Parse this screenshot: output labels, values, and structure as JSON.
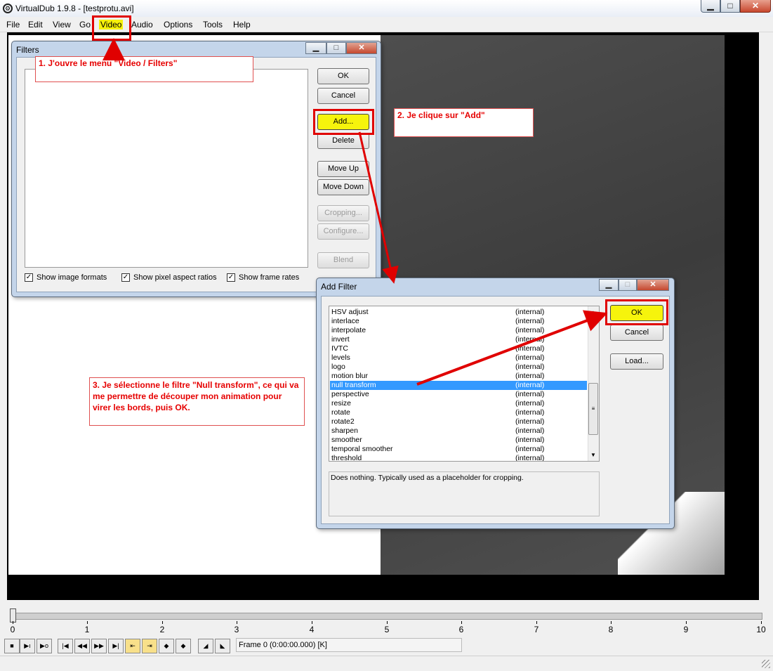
{
  "window": {
    "title": "VirtualDub 1.9.8 - [testprotu.avi]",
    "minimize": "▁",
    "maximize": "□",
    "close": "✕"
  },
  "menu": {
    "items": [
      "File",
      "Edit",
      "View",
      "Go",
      "Video",
      "Audio",
      "Options",
      "Tools",
      "Help"
    ]
  },
  "filters_dialog": {
    "title": "Filters",
    "buttons": {
      "ok": "OK",
      "cancel": "Cancel",
      "add": "Add...",
      "delete": "Delete",
      "move_up": "Move Up",
      "move_down": "Move Down",
      "cropping": "Cropping...",
      "configure": "Configure...",
      "blend": "Blend"
    },
    "checkboxes": {
      "show_image_formats": "Show image formats",
      "show_pixel_aspect_ratios": "Show pixel aspect ratios",
      "show_frame_rates": "Show frame rates"
    }
  },
  "add_filter_dialog": {
    "title": "Add Filter",
    "buttons": {
      "ok": "OK",
      "cancel": "Cancel",
      "load": "Load..."
    },
    "filters": [
      {
        "name": "HSV adjust",
        "source": "(internal)"
      },
      {
        "name": "interlace",
        "source": "(internal)"
      },
      {
        "name": "interpolate",
        "source": "(internal)"
      },
      {
        "name": "invert",
        "source": "(internal)"
      },
      {
        "name": "IVTC",
        "source": "(internal)"
      },
      {
        "name": "levels",
        "source": "(internal)"
      },
      {
        "name": "logo",
        "source": "(internal)"
      },
      {
        "name": "motion blur",
        "source": "(internal)"
      },
      {
        "name": "null transform",
        "source": "(internal)",
        "selected": true
      },
      {
        "name": "perspective",
        "source": "(internal)"
      },
      {
        "name": "resize",
        "source": "(internal)"
      },
      {
        "name": "rotate",
        "source": "(internal)"
      },
      {
        "name": "rotate2",
        "source": "(internal)"
      },
      {
        "name": "sharpen",
        "source": "(internal)"
      },
      {
        "name": "smoother",
        "source": "(internal)"
      },
      {
        "name": "temporal smoother",
        "source": "(internal)"
      },
      {
        "name": "threshold",
        "source": "(internal)"
      }
    ],
    "description": "Does nothing. Typically used as a placeholder for cropping."
  },
  "annotations": {
    "step1": "1. J'ouvre le menu \"Video / Filters\"",
    "step2": "2. Je clique sur \"Add\"",
    "step3": "3. Je sélectionne le filtre \"Null transform\", ce qui va me permettre de découper mon animation pour virer les bords, puis OK."
  },
  "timeline": {
    "ticks": [
      "0",
      "1",
      "2",
      "3",
      "4",
      "5",
      "6",
      "7",
      "8",
      "9",
      "10"
    ],
    "position": 0,
    "frame_label": "Frame 0 (0:00:00.000) [K]"
  },
  "colors": {
    "highlight": "#f6f40c",
    "annotation_red": "#e00000",
    "selection_blue": "#3399ff"
  }
}
